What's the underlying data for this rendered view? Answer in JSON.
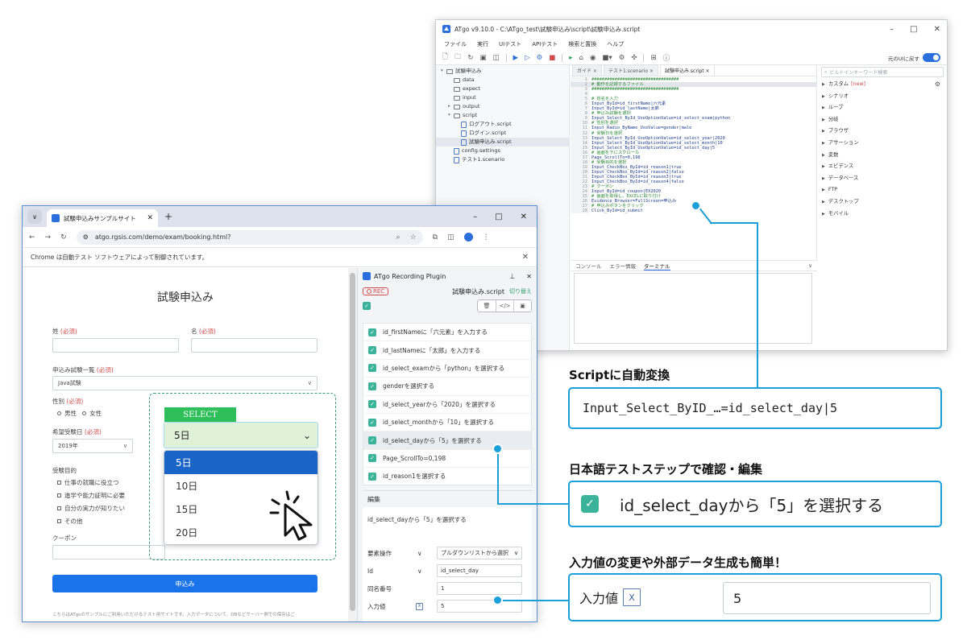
{
  "ide": {
    "title": "ATgo v9.10.0 - C:\\ATgo_test\\試験申込み\\script\\試験申込み.script",
    "menu": [
      "ファイル",
      "実行",
      "UIテスト",
      "APIテスト",
      "検索と置換",
      "ヘルプ"
    ],
    "toolbar_right_label": "元のUIに戻す",
    "tree": [
      {
        "label": "試験申込み",
        "indent": 0,
        "tw": "▾",
        "type": "folder"
      },
      {
        "label": "data",
        "indent": 1,
        "tw": "",
        "type": "folder"
      },
      {
        "label": "expect",
        "indent": 1,
        "tw": "",
        "type": "folder"
      },
      {
        "label": "input",
        "indent": 1,
        "tw": "",
        "type": "folder"
      },
      {
        "label": "output",
        "indent": 1,
        "tw": "▸",
        "type": "folder"
      },
      {
        "label": "script",
        "indent": 1,
        "tw": "▾",
        "type": "folder"
      },
      {
        "label": "ログアウト.script",
        "indent": 2,
        "tw": "",
        "type": "script"
      },
      {
        "label": "ログイン.script",
        "indent": 2,
        "tw": "",
        "type": "script"
      },
      {
        "label": "試験申込み.script",
        "indent": 2,
        "tw": "",
        "type": "script",
        "selected": true
      },
      {
        "label": "config.settings",
        "indent": 1,
        "tw": "",
        "type": "script"
      },
      {
        "label": "テスト1.scenario",
        "indent": 1,
        "tw": "",
        "type": "script"
      }
    ],
    "tabs": [
      "ガイド ×",
      "テスト1.scenario ×",
      "試験申込み.script ×"
    ],
    "code": [
      "##################################",
      "# 動作を記録するファイル",
      "##################################",
      "",
      "# 姓名を入力",
      "Input_ById=id_firstName|六元素",
      "Input_ById=id_lastName|太郎",
      "# 申込み試験を選択",
      "Input_Select_ById_UseOptionValue=id_select_exam|python",
      "# 性別を選択",
      "Input_Radio_ByName_UseValue=gender|male",
      "# 受験日を選択",
      "Input_Select_ById_UseOptionValue=id_select_year|2020",
      "Input_Select_ById_UseOptionValue=id_select_month|10",
      "Input_Select_ById_UseOptionValue=id_select_day|5",
      "# 画面を下にスクロール",
      "Page_ScrollTo=0,198",
      "# 受験目的を選択",
      "Input_CheckBox_ById=id_reason1|true",
      "Input_CheckBox_ById=id_reason2|false",
      "Input_CheckBox_ById=id_reason3|true",
      "Input_CheckBox_ById=id_reason4|false",
      "# クーポン",
      "Input_ById=id_coupon|EX2020",
      "# 画面を取得し、EXCELに取り付け",
      "Evidence_Browser=FullScreen=申込み",
      "# 申込みボタンをクリック",
      "Click_ById=id_submit"
    ],
    "bottom_tabs": [
      "コンソール",
      "エラー情報",
      "ターミナル"
    ],
    "keyword_search_placeholder": "ビルトインキーワード検索",
    "keywords": [
      {
        "label": "カスタム",
        "badge": "[new]"
      },
      {
        "label": "シナリオ"
      },
      {
        "label": "ループ"
      },
      {
        "label": "分岐"
      },
      {
        "label": "ブラウザ"
      },
      {
        "label": "アサーション"
      },
      {
        "label": "変数"
      },
      {
        "label": "エビデンス"
      },
      {
        "label": "データベース"
      },
      {
        "label": "FTP"
      },
      {
        "label": "デスクトップ"
      },
      {
        "label": "モバイル"
      }
    ]
  },
  "browser": {
    "tab_title": "試験申込みサンプルサイト",
    "url": "atgo.rgsis.com/demo/exam/booking.html?",
    "info_bar": "Chrome は自動テスト ソフトウェアによって制御されています。",
    "page": {
      "title": "試験申込み",
      "required": "(必須)",
      "last_name_label": "姓",
      "first_name_label": "名",
      "exam_label": "申込み試験一覧",
      "exam_value": "Java試験",
      "gender_label": "性別",
      "gender_options": [
        "男性",
        "女性"
      ],
      "date_label": "希望受験日",
      "year_value": "2019年",
      "purpose_label": "受験目的",
      "purposes": [
        "仕事の就職に役立つ",
        "進学や能力証明に必要",
        "自分の実力が知りたい",
        "その他"
      ],
      "coupon_label": "クーポン",
      "submit_label": "申込み",
      "footer": "こちらはATgoのサンプルにご利用いただけるテスト用サイトです。入力データについて、DBなどサーバー側での保存はご",
      "select_tag": "SELECT",
      "select_value": "5日",
      "day_options": [
        "5日",
        "10日",
        "15日",
        "20日"
      ]
    },
    "plugin": {
      "title": "ATgo Recording Plugin",
      "rec_label": "REC",
      "file_name": "試験申込み.script",
      "switch_label": "切り替え",
      "steps": [
        "id_firstNameに「六元素」を入力する",
        "id_lastNameに「太郎」を入力する",
        "id_select_examから「python」を選択する",
        "genderを選択する",
        "id_select_yearから「2020」を選択する",
        "id_select_monthから「10」を選択する",
        "id_select_dayから「5」を選択する",
        "Page_ScrollTo=0,198",
        "id_reason1を選択する"
      ],
      "edit_title": "編集",
      "edit_desc": "id_select_dayから「5」を選択する",
      "edit_rows": [
        {
          "key": "要素操作",
          "dd": "∨",
          "value": "プルダウンリストから選択",
          "has_arrow": true
        },
        {
          "key": "Id",
          "dd": "∨",
          "value": "id_select_day",
          "has_arrow": false
        },
        {
          "key": "同名番号",
          "dd": "",
          "value": "1",
          "has_arrow": false
        },
        {
          "key": "入力値",
          "dd": "",
          "value": "5",
          "has_arrow": false,
          "xls": true
        }
      ]
    }
  },
  "callouts": {
    "script_title": "Scriptに自動変換",
    "script_value": "Input_Select_ByID_…=id_select_day|5",
    "step_title": "日本語テストステップで確認・編集",
    "step_value": "id_select_dayから「5」を選択する",
    "input_title": "入力値の変更や外部データ生成も簡単！",
    "input_label": "入力値",
    "input_value": "5"
  },
  "colors": {
    "accent": "#1a9fd8",
    "brand": "#2a6fdb",
    "required": "#d24b4b",
    "select_tag": "#2fbf5a"
  }
}
